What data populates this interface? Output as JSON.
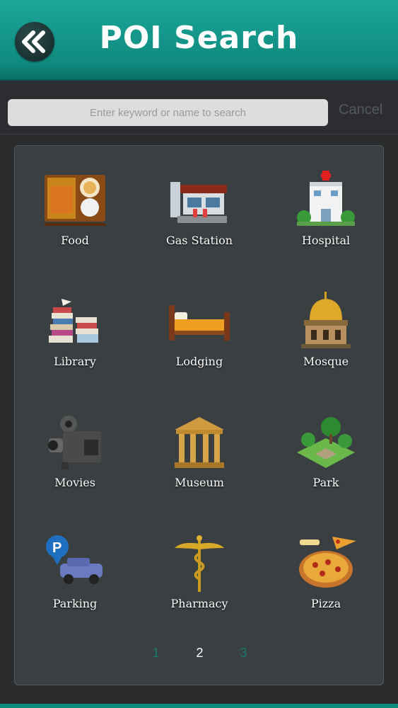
{
  "header": {
    "title": "POI Search",
    "back_icon": "double-chevron-left-icon"
  },
  "search": {
    "placeholder": "Enter keyword or name to search",
    "cancel_label": "Cancel"
  },
  "categories": [
    {
      "label": "Food",
      "icon": "bento-box-icon"
    },
    {
      "label": "Gas Station",
      "icon": "gas-station-icon"
    },
    {
      "label": "Hospital",
      "icon": "hospital-icon"
    },
    {
      "label": "Library",
      "icon": "book-stack-icon"
    },
    {
      "label": "Lodging",
      "icon": "bed-icon"
    },
    {
      "label": "Mosque",
      "icon": "mosque-icon"
    },
    {
      "label": "Movies",
      "icon": "movie-camera-icon"
    },
    {
      "label": "Museum",
      "icon": "museum-icon"
    },
    {
      "label": "Park",
      "icon": "park-icon"
    },
    {
      "label": "Parking",
      "icon": "parking-car-icon"
    },
    {
      "label": "Pharmacy",
      "icon": "caduceus-icon"
    },
    {
      "label": "Pizza",
      "icon": "pizza-icon"
    }
  ],
  "pagination": {
    "pages": [
      "1",
      "2",
      "3"
    ],
    "current": "2"
  },
  "colors": {
    "header": "#0f8a7e",
    "panel": "#3a3f42",
    "background": "#2a2c2e"
  }
}
